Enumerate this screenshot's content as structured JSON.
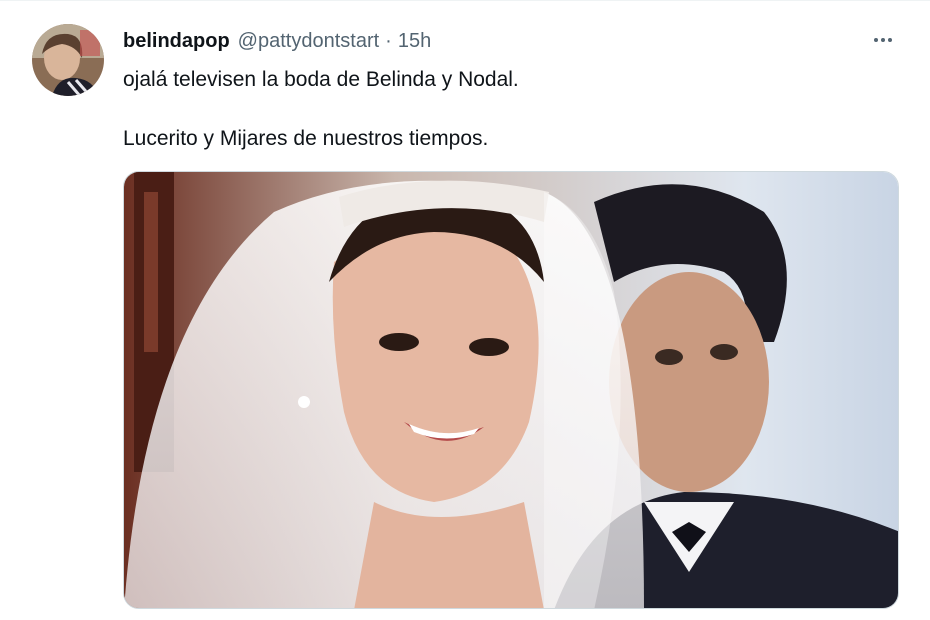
{
  "tweet": {
    "author": {
      "display_name": "belindapop",
      "handle": "@pattydontstart",
      "separator": "·",
      "timestamp": "15h"
    },
    "text_lines": [
      "ojalá televisen la boda de Belinda y Nodal.",
      "Lucerito y Mijares de nuestros tiempos."
    ],
    "more_icon": "more-horizontal-icon",
    "media": {
      "type": "photo"
    }
  },
  "colors": {
    "text_primary": "#0f1419",
    "text_secondary": "#536471",
    "border": "#cfd9de"
  }
}
